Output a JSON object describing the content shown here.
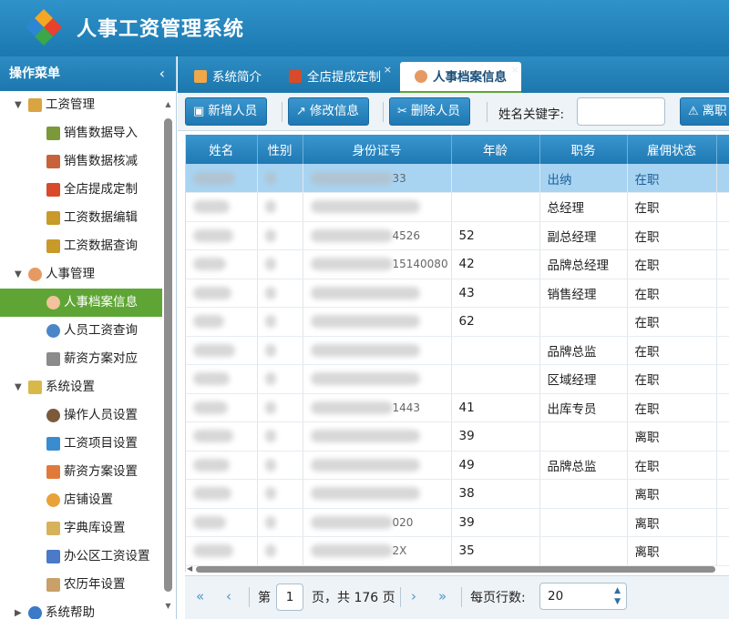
{
  "app": {
    "title": "人事工资管理系统"
  },
  "sidebar": {
    "header": "操作菜单",
    "collapse_icon": "‹",
    "groups": [
      {
        "label": "工资管理",
        "items": [
          "销售数据导入",
          "销售数据核减",
          "全店提成定制",
          "工资数据编辑",
          "工资数据查询"
        ]
      },
      {
        "label": "人事管理",
        "items": [
          "人事档案信息",
          "人员工资查询",
          "薪资方案对应"
        ]
      },
      {
        "label": "系统设置",
        "items": [
          "操作人员设置",
          "工资项目设置",
          "薪资方案设置",
          "店铺设置",
          "字典库设置",
          "办公区工资设置",
          "农历年设置"
        ]
      },
      {
        "label": "系统帮助",
        "items": []
      }
    ]
  },
  "tabs": [
    {
      "label": "系统简介"
    },
    {
      "label": "全店提成定制",
      "close": "×"
    },
    {
      "label": "人事档案信息",
      "close": "×"
    }
  ],
  "toolbar": {
    "add_label": "新增人员",
    "edit_label": "修改信息",
    "delete_label": "删除人员",
    "search_label": "姓名关键字:",
    "search_value": "",
    "resign_label": "离职"
  },
  "table": {
    "columns": [
      "姓名",
      "性别",
      "身份证号",
      "年龄",
      "职务",
      "雇佣状态",
      ""
    ],
    "rows": [
      {
        "id_tail": "33",
        "age": "",
        "position": "出纳",
        "status": "在职"
      },
      {
        "id_tail": "",
        "age": "",
        "position": "总经理",
        "status": "在职"
      },
      {
        "id_tail": "4526",
        "age": "52",
        "position": "副总经理",
        "status": "在职"
      },
      {
        "id_tail": "15140080",
        "age": "42",
        "position": "品牌总经理",
        "status": "在职"
      },
      {
        "id_tail": "",
        "age": "43",
        "position": "销售经理",
        "status": "在职"
      },
      {
        "id_tail": "",
        "age": "62",
        "position": "",
        "status": "在职"
      },
      {
        "id_tail": "",
        "age": "",
        "position": "品牌总监",
        "status": "在职"
      },
      {
        "id_tail": "",
        "age": "",
        "position": "区域经理",
        "status": "在职"
      },
      {
        "id_tail": "1443",
        "age": "41",
        "position": "出库专员",
        "status": "在职"
      },
      {
        "id_tail": "",
        "age": "39",
        "position": "",
        "status": "离职"
      },
      {
        "id_tail": "",
        "age": "49",
        "position": "品牌总监",
        "status": "在职"
      },
      {
        "id_tail": "",
        "age": "38",
        "position": "",
        "status": "离职"
      },
      {
        "id_tail": "020",
        "age": "39",
        "position": "",
        "status": "离职"
      },
      {
        "id_tail": "2X",
        "age": "35",
        "position": "",
        "status": "离职"
      }
    ]
  },
  "pager": {
    "first": "«",
    "prev": "‹",
    "page_prefix": "第",
    "page": "1",
    "page_suffix": "页，共 176 页",
    "next": "›",
    "last": "»",
    "rows_label": "每页行数:",
    "rows_per_page": "20"
  },
  "colors": {
    "header_blue": "#1f7ab3",
    "active_green": "#5fa535",
    "selected_row": "#a8d4f2"
  },
  "icons": [
    "logo",
    "home-icon",
    "tab-doc-icon",
    "person-icon",
    "add-user-icon",
    "edit-icon",
    "scissors-icon",
    "warning-icon"
  ]
}
